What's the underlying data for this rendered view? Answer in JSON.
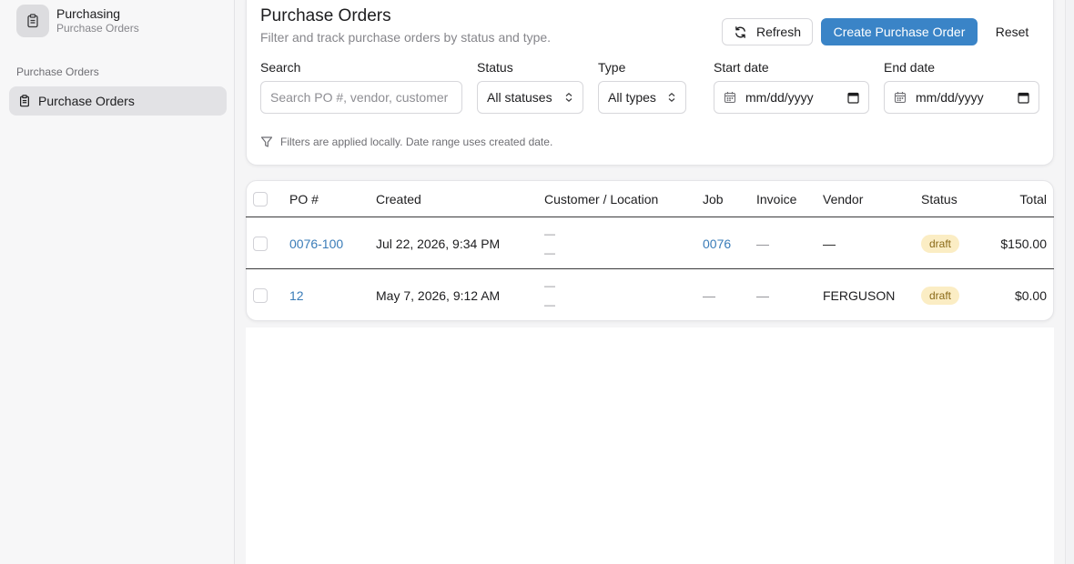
{
  "sidebar": {
    "app_title": "Purchasing",
    "app_subtitle": "Purchase Orders",
    "section_label": "Purchase Orders",
    "items": [
      {
        "label": "Purchase Orders",
        "icon": "clipboard-icon",
        "active": true
      }
    ]
  },
  "header": {
    "title": "Purchase Orders",
    "subtitle": "Filter and track purchase orders by status and type."
  },
  "toolbar": {
    "refresh_label": "Refresh",
    "create_label": "Create Purchase Order",
    "reset_label": "Reset"
  },
  "filters": {
    "search_label": "Search",
    "search_placeholder": "Search PO #, vendor, customer",
    "status_label": "Status",
    "status_value": "All statuses",
    "type_label": "Type",
    "type_value": "All types",
    "start_label": "Start date",
    "start_value": "mm/dd/yyyy",
    "end_label": "End date",
    "end_value": "mm/dd/yyyy",
    "note": "Filters are applied locally. Date range uses created date."
  },
  "table": {
    "columns": [
      "PO #",
      "Created",
      "Customer / Location",
      "Job",
      "Invoice",
      "Vendor",
      "Status",
      "Total"
    ],
    "rows": [
      {
        "po": "0076-100",
        "created": "Jul 22, 2026, 9:34 PM",
        "customer": "—",
        "location": "—",
        "job": "0076",
        "invoice": "—",
        "vendor": "—",
        "status": "draft",
        "total": "$150.00"
      },
      {
        "po": "12",
        "created": "May 7, 2026, 9:12 AM",
        "customer": "—",
        "location": "—",
        "job": "—",
        "invoice": "—",
        "vendor": "FERGUSON",
        "status": "draft",
        "total": "$0.00"
      }
    ]
  },
  "colors": {
    "accent": "#3a84c7",
    "link": "#3a7cb8",
    "draft_badge_bg": "#fbedc4",
    "draft_badge_text": "#8a6a18"
  }
}
